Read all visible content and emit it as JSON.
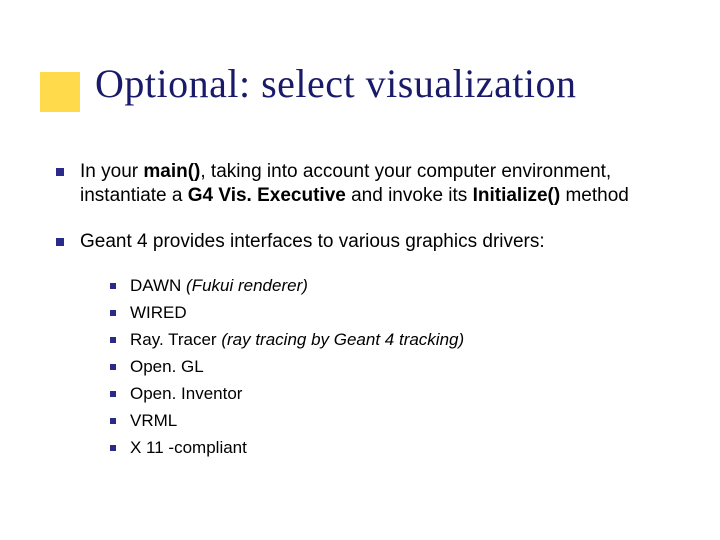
{
  "title": "Optional: select visualization",
  "bullets": [
    {
      "pre": "In your ",
      "b1": "main()",
      "mid1": ", taking into account your computer environment, instantiate a ",
      "b2": "G4 Vis. Executive",
      "mid2": " and invoke its ",
      "b3": "Initialize()",
      "post": " method"
    },
    {
      "text": "Geant 4 provides interfaces to various graphics drivers:"
    }
  ],
  "drivers": [
    {
      "name": "DAWN ",
      "note": "(Fukui renderer)"
    },
    {
      "name": "WIRED",
      "note": ""
    },
    {
      "name": "Ray. Tracer ",
      "note": "(ray tracing by Geant 4 tracking)"
    },
    {
      "name": "Open. GL",
      "note": ""
    },
    {
      "name": "Open. Inventor",
      "note": ""
    },
    {
      "name": "VRML",
      "note": ""
    },
    {
      "name": "X 11 -compliant",
      "note": ""
    }
  ]
}
